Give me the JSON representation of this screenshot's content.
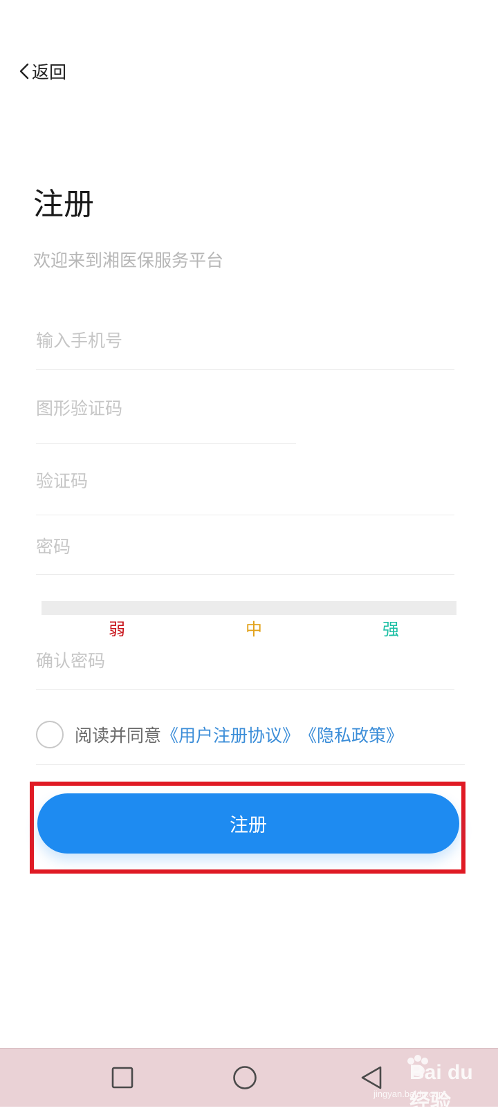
{
  "header": {
    "back_label": "返回"
  },
  "title": "注册",
  "subtitle": "欢迎来到湘医保服务平台",
  "fields": {
    "phone_placeholder": "输入手机号",
    "captcha_placeholder": "图形验证码",
    "sms_code_placeholder": "验证码",
    "password_placeholder": "密码",
    "confirm_password_placeholder": "确认密码"
  },
  "password_strength": {
    "weak": "弱",
    "medium": "中",
    "strong": "强",
    "colors": {
      "weak": "#c8161d",
      "medium": "#e2a21b",
      "strong": "#1cbfa4"
    }
  },
  "agreement": {
    "checked": false,
    "text": "阅读并同意",
    "user_agreement_link": "《用户注册协议》",
    "privacy_link": "《隐私政策》"
  },
  "register_button": {
    "label": "注册",
    "color": "#1e8bf1"
  },
  "nav": {
    "recents_icon": "square-icon",
    "home_icon": "circle-icon",
    "back_icon": "triangle-back-icon"
  },
  "watermark": {
    "text": "Bai du 经验",
    "sub": "jingyan.baidu.com"
  }
}
